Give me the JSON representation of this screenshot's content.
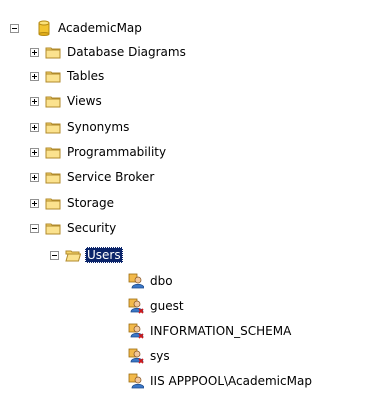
{
  "tree": {
    "root": {
      "label": "AcademicMap",
      "icon": "database-icon",
      "expanded": true
    },
    "folders": [
      {
        "label": "Database Diagrams",
        "icon": "folder-icon",
        "expanded": false
      },
      {
        "label": "Tables",
        "icon": "folder-icon",
        "expanded": false
      },
      {
        "label": "Views",
        "icon": "folder-icon",
        "expanded": false
      },
      {
        "label": "Synonyms",
        "icon": "folder-icon",
        "expanded": false
      },
      {
        "label": "Programmability",
        "icon": "folder-icon",
        "expanded": false
      },
      {
        "label": "Service Broker",
        "icon": "folder-icon",
        "expanded": false
      },
      {
        "label": "Storage",
        "icon": "folder-icon",
        "expanded": false
      },
      {
        "label": "Security",
        "icon": "folder-icon",
        "expanded": true
      }
    ],
    "users_folder": {
      "label": "Users",
      "icon": "folder-open-icon",
      "expanded": true,
      "selected": true
    },
    "users": [
      {
        "label": "dbo",
        "icon": "user-icon"
      },
      {
        "label": "guest",
        "icon": "user-disabled-icon"
      },
      {
        "label": "INFORMATION_SCHEMA",
        "icon": "user-disabled-icon"
      },
      {
        "label": "sys",
        "icon": "user-disabled-icon"
      },
      {
        "label": "IIS APPPOOL\\AcademicMap",
        "icon": "user-icon"
      }
    ]
  },
  "colors": {
    "selection_bg": "#0a246a",
    "folder_fill": "#f6d46b",
    "database_fill": "#f2c431"
  }
}
